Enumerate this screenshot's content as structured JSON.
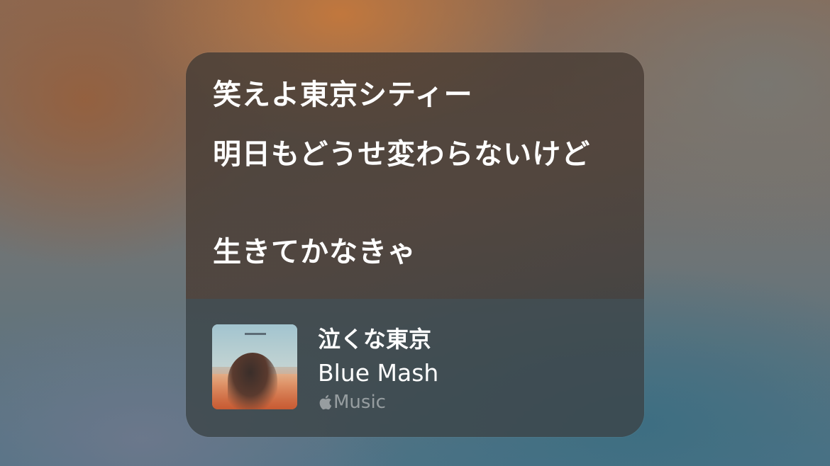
{
  "lyrics": {
    "line1": "笑えよ東京シティー",
    "line2": "明日もどうせ変わらないけど",
    "line3": "生きてかなきゃ"
  },
  "track": {
    "title": "泣くな東京",
    "artist": "Blue Mash",
    "service_label": "Music",
    "service_icon": "apple-logo-icon"
  },
  "colors": {
    "text_primary": "#ffffff",
    "text_secondary": "rgba(255,255,255,0.45)"
  }
}
